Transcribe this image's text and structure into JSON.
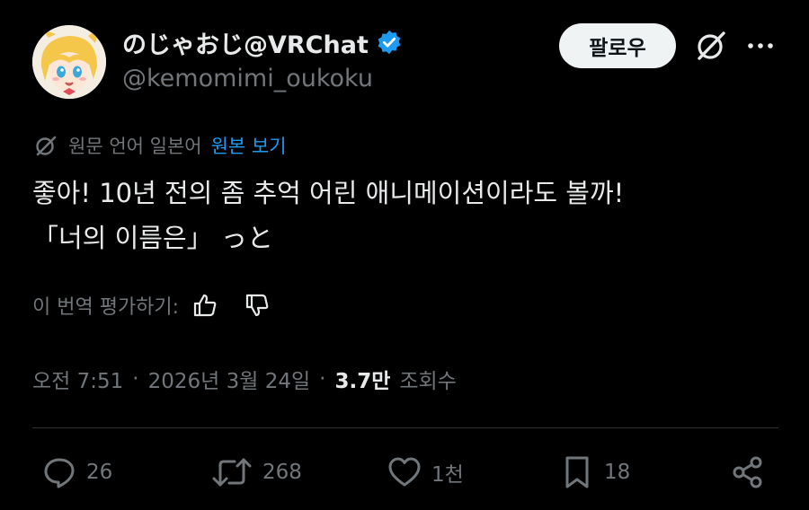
{
  "author": {
    "display_name": "のじゃおじ@VRChat",
    "handle": "@kemomimi_oukoku",
    "verified": true
  },
  "header": {
    "follow_label": "팔로우"
  },
  "translation": {
    "label": "원문 언어 일본어",
    "link": "원본 보기"
  },
  "tweet": {
    "lines": [
      "좋아! 10년 전의 좀 추억 어린 애니메이션이라도 볼까!",
      "「너의 이름은」 っと"
    ]
  },
  "rate": {
    "label": "이 번역 평가하기:"
  },
  "meta": {
    "time": "오전 7:51",
    "sep1": "·",
    "date": "2026년 3월 24일",
    "sep2": "·",
    "views_count": "3.7만",
    "views_label": "조회수"
  },
  "actions": {
    "replies": "26",
    "reposts": "268",
    "likes": "1천",
    "bookmarks": "18"
  },
  "colors": {
    "background": "#000000",
    "text": "#e7e9ea",
    "secondary": "#71767b",
    "accent": "#1d9bf0",
    "divider": "#2f3336",
    "follow_bg": "#eff3f4"
  },
  "icons": {
    "verified": "verified-badge-icon",
    "grok": "grok-icon",
    "more": "more-horizontal-icon",
    "reply": "reply-icon",
    "repost": "repost-icon",
    "like": "heart-icon",
    "bookmark": "bookmark-icon",
    "share": "share-icon"
  }
}
